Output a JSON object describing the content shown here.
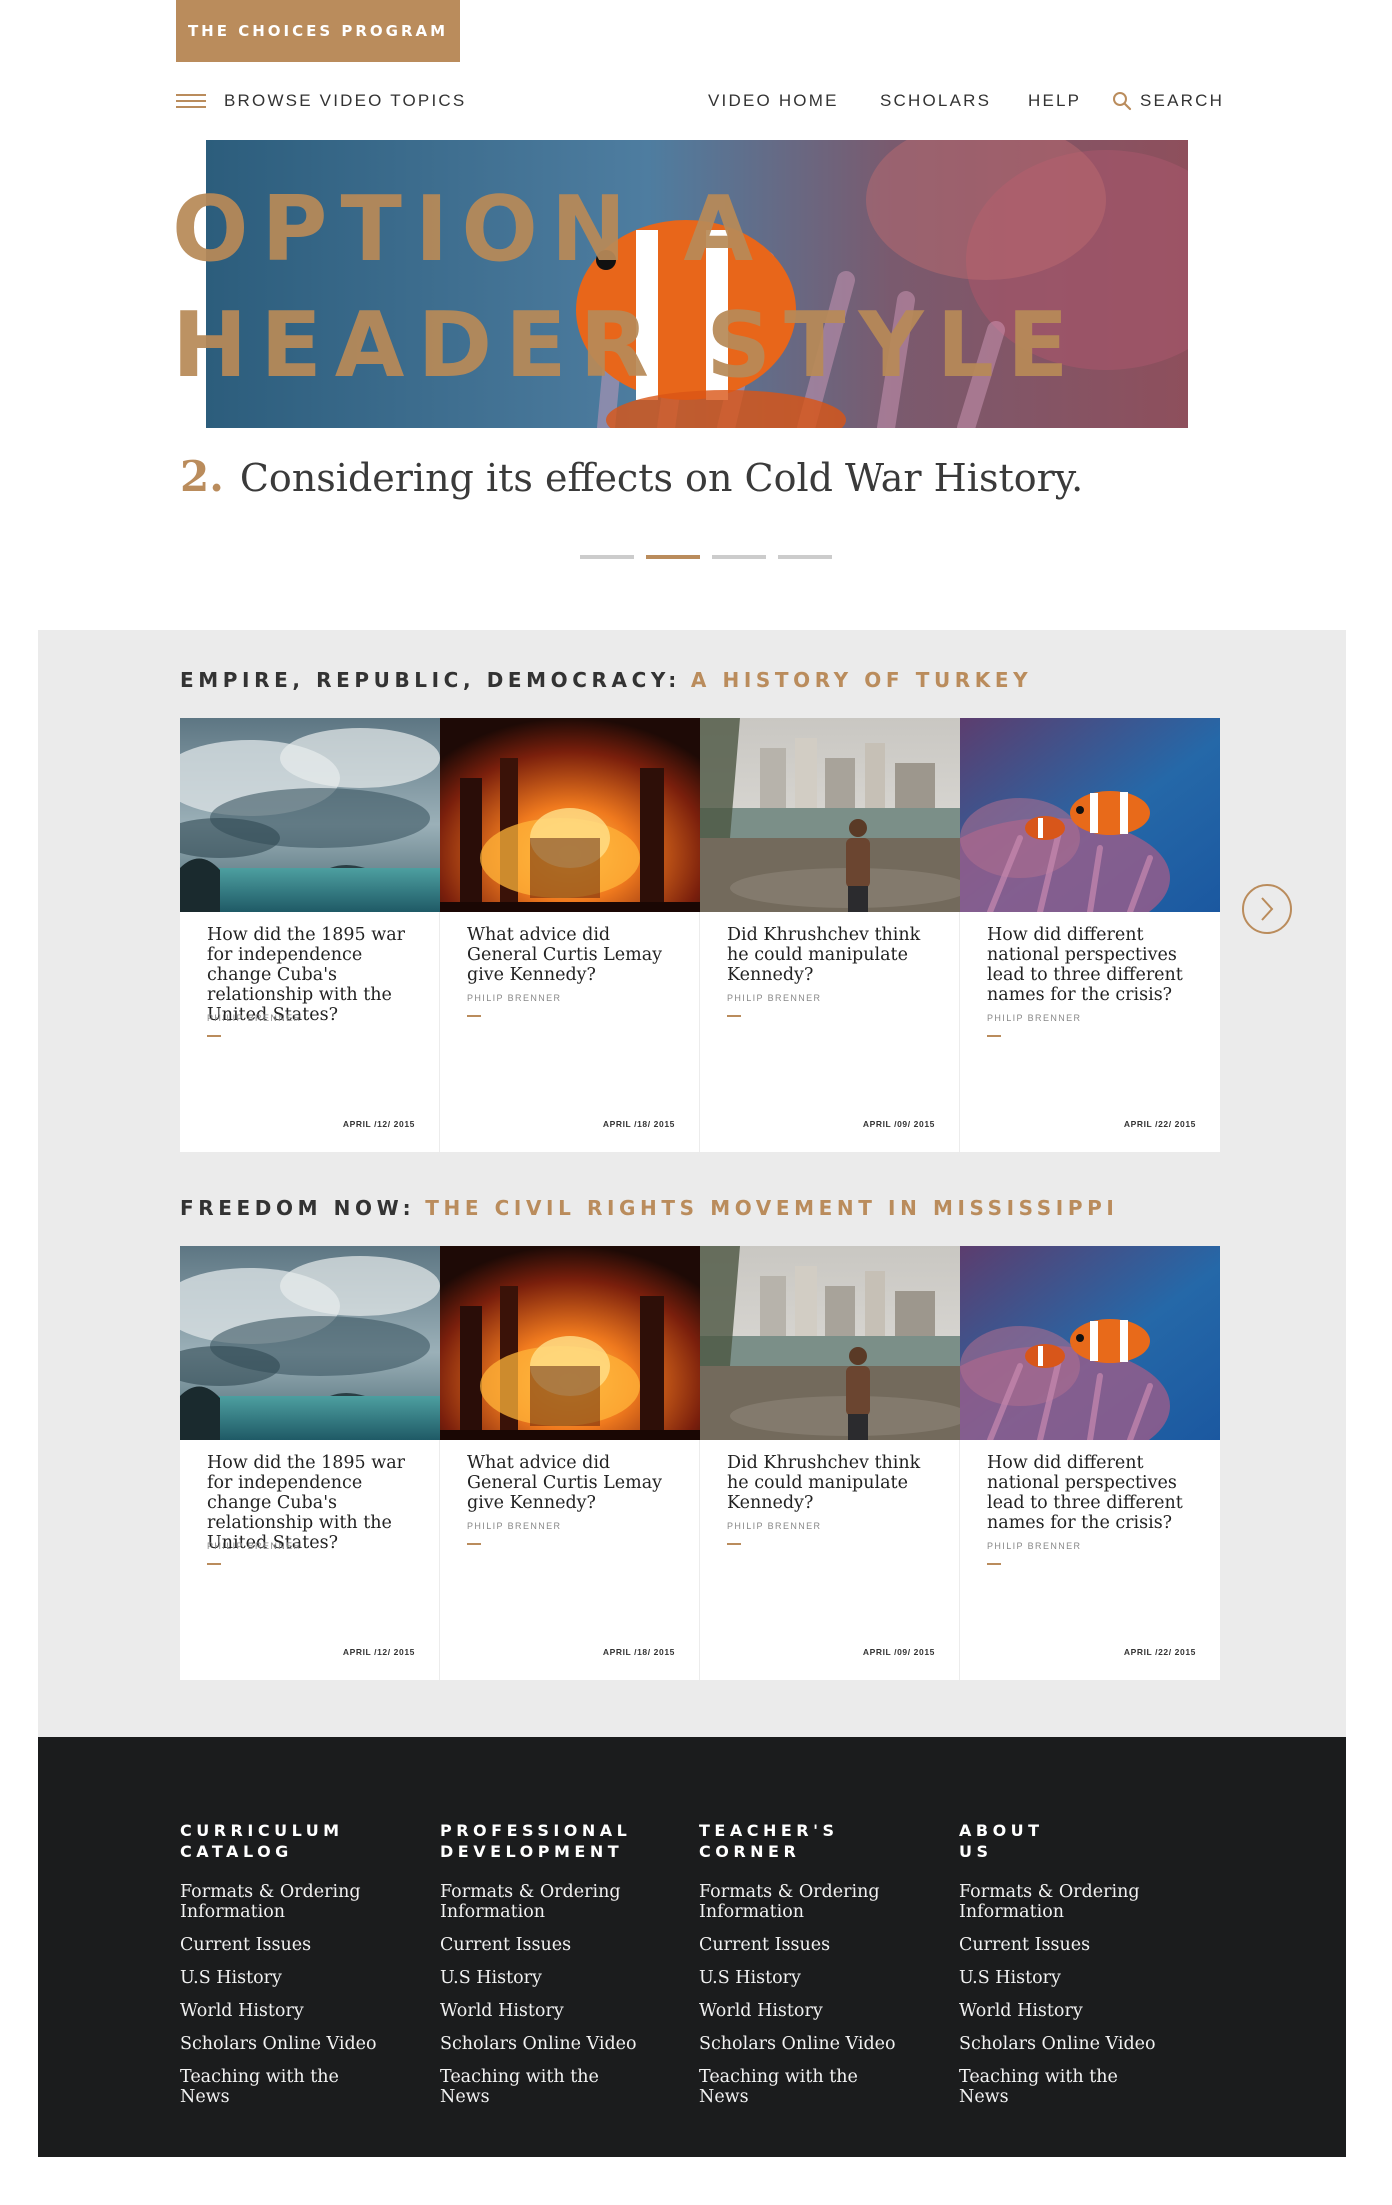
{
  "header": {
    "brand": "THE CHOICES PROGRAM",
    "browse_label": "BROWSE VIDEO TOPICS",
    "nav": [
      "VIDEO HOME",
      "SCHOLARS",
      "HELP"
    ],
    "search_label": "SEARCH"
  },
  "hero": {
    "title_line1": "OPTION A",
    "title_line2": "HEADER STYLE",
    "subtitle_number": "2.",
    "subtitle_text": "Considering its effects on Cold War History.",
    "slide_count": 4,
    "active_slide": 2
  },
  "sections": [
    {
      "title": "EMPIRE, REPUBLIC, DEMOCRACY:",
      "accent": "A HISTORY OF TURKEY",
      "cards": [
        {
          "image": "stormy-sea-clouds",
          "question": "How did the 1895 war for independence change Cuba's relationship with the United States?",
          "author": "PHILIP BRENNER",
          "date": "APRIL /12/ 2015"
        },
        {
          "image": "burning-refinery",
          "question": "What advice did General Curtis Lemay give Kennedy?",
          "author": "PHILIP BRENNER",
          "date": "APRIL /18/ 2015"
        },
        {
          "image": "child-by-riverbank-city",
          "question": "Did Khrushchev think he could manipulate Kennedy?",
          "author": "PHILIP BRENNER",
          "date": "APRIL /09/ 2015"
        },
        {
          "image": "clownfish-anemone",
          "question": "How did different national perspectives lead to three different names for the crisis?",
          "author": "PHILIP BRENNER",
          "date": "APRIL /22/ 2015"
        }
      ]
    },
    {
      "title": "FREEDOM NOW:",
      "accent": "THE CIVIL RIGHTS MOVEMENT IN MISSISSIPPI",
      "cards": [
        {
          "image": "stormy-sea-clouds",
          "question": "How did the 1895 war for independence change Cuba's relationship with the United States?",
          "author": "PHILIP BRENNER",
          "date": "APRIL /12/ 2015"
        },
        {
          "image": "burning-refinery",
          "question": "What advice did General Curtis Lemay give Kennedy?",
          "author": "PHILIP BRENNER",
          "date": "APRIL /18/ 2015"
        },
        {
          "image": "child-by-riverbank-city",
          "question": "Did Khrushchev think he could manipulate Kennedy?",
          "author": "PHILIP BRENNER",
          "date": "APRIL /09/ 2015"
        },
        {
          "image": "clownfish-anemone",
          "question": "How did different national perspectives lead to three different names for the crisis?",
          "author": "PHILIP BRENNER",
          "date": "APRIL /22/ 2015"
        }
      ]
    }
  ],
  "footer": {
    "columns": [
      {
        "heading_line1": "CURRICULUM",
        "heading_line2": "CATALOG",
        "links": [
          "Formats & Ordering Information",
          "Current Issues",
          "U.S History",
          "World History",
          "Scholars Online Video",
          "Teaching with the News"
        ]
      },
      {
        "heading_line1": "PROFESSIONAL",
        "heading_line2": "DEVELOPMENT",
        "links": [
          "Formats & Ordering Information",
          "Current Issues",
          "U.S History",
          "World History",
          "Scholars Online Video",
          "Teaching with the News"
        ]
      },
      {
        "heading_line1": "TEACHER'S",
        "heading_line2": "CORNER",
        "links": [
          "Formats & Ordering Information",
          "Current Issues",
          "U.S History",
          "World History",
          "Scholars Online Video",
          "Teaching with the News"
        ]
      },
      {
        "heading_line1": "ABOUT",
        "heading_line2": "US",
        "links": [
          "Formats & Ordering Information",
          "Current Issues",
          "U.S History",
          "World History",
          "Scholars Online Video",
          "Teaching with the News"
        ]
      }
    ]
  },
  "colors": {
    "accent": "#ba8c5c",
    "footer_bg": "#1b1c1d",
    "section_bg": "#ebebeb"
  }
}
